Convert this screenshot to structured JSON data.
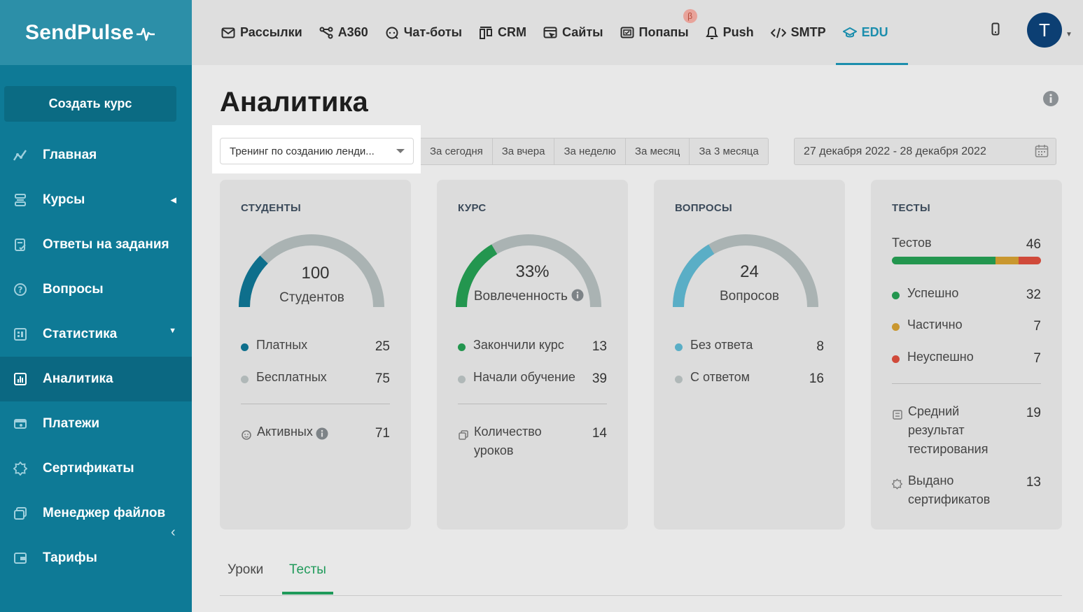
{
  "brand": {
    "name": "SendPulse"
  },
  "sidebar": {
    "create_button": "Создать курс",
    "items": [
      {
        "label": "Главная",
        "icon": "chart-line-icon"
      },
      {
        "label": "Курсы",
        "icon": "layers-icon"
      },
      {
        "label": "Ответы на задания",
        "icon": "task-check-icon"
      },
      {
        "label": "Вопросы",
        "icon": "question-icon"
      },
      {
        "label": "Статистика",
        "icon": "stats-icon"
      },
      {
        "label": "Аналитика",
        "icon": "analytics-icon",
        "active": true
      },
      {
        "label": "Платежи",
        "icon": "wallet-icon"
      },
      {
        "label": "Сертификаты",
        "icon": "certificate-icon"
      },
      {
        "label": "Менеджер файлов",
        "icon": "files-icon"
      },
      {
        "label": "Тарифы",
        "icon": "pricing-icon"
      }
    ]
  },
  "topnav": {
    "items": [
      {
        "label": "Рассылки",
        "icon": "mail-icon"
      },
      {
        "label": "A360",
        "icon": "flow-icon"
      },
      {
        "label": "Чат-боты",
        "icon": "chat-icon"
      },
      {
        "label": "CRM",
        "icon": "crm-icon"
      },
      {
        "label": "Сайты",
        "icon": "sites-icon"
      },
      {
        "label": "Попапы",
        "icon": "popup-icon",
        "badge": "β"
      },
      {
        "label": "Push",
        "icon": "bell-icon"
      },
      {
        "label": "SMTP",
        "icon": "code-icon"
      },
      {
        "label": "EDU",
        "icon": "graduation-cap-icon",
        "active": true
      }
    ],
    "avatar_letter": "T"
  },
  "page": {
    "title": "Аналитика",
    "course_select": "Тренинг по созданию ленди...",
    "periods": [
      "За сегодня",
      "За вчера",
      "За неделю",
      "За месяц",
      "За 3 месяца"
    ],
    "date_range": "27 декабря 2022 - 28 декабря 2022"
  },
  "cards": {
    "students": {
      "title": "СТУДЕНТЫ",
      "value": "100",
      "label": "Студентов",
      "gauge_fraction": 0.25,
      "rows": [
        {
          "label": "Платных",
          "value": "25",
          "color": "#0e6f8c"
        },
        {
          "label": "Бесплатных",
          "value": "75",
          "color": "#b0b8b8"
        }
      ],
      "extra": {
        "label": "Активных",
        "value": "71"
      }
    },
    "course": {
      "title": "КУРС",
      "value": "33%",
      "label": "Вовлеченность",
      "gauge_fraction": 0.33,
      "rows": [
        {
          "label": "Закончили курс",
          "value": "13",
          "color": "#23964f"
        },
        {
          "label": "Начали обучение",
          "value": "39",
          "color": "#b0b8b8"
        }
      ],
      "extra": {
        "label_line1": "Количество",
        "label_line2": "уроков",
        "value": "14"
      }
    },
    "questions": {
      "title": "ВОПРОСЫ",
      "value": "24",
      "label": "Вопросов",
      "gauge_fraction": 0.33,
      "rows": [
        {
          "label": "Без ответа",
          "value": "8",
          "color": "#5aaec6"
        },
        {
          "label": "С ответом",
          "value": "16",
          "color": "#b0b8b8"
        }
      ]
    },
    "tests": {
      "title": "ТЕСТЫ",
      "total_label": "Тестов",
      "total": "46",
      "rows": [
        {
          "label": "Успешно",
          "value": "32",
          "color": "#23964f"
        },
        {
          "label": "Частично",
          "value": "7",
          "color": "#c9972f"
        },
        {
          "label": "Неуспешно",
          "value": "7",
          "color": "#d04a3a"
        }
      ],
      "avg": {
        "l1": "Средний",
        "l2": "результат",
        "l3": "тестирования",
        "value": "19"
      },
      "certs": {
        "l1": "Выдано",
        "l2": "сертификатов",
        "value": "13"
      }
    }
  },
  "tabs": [
    "Уроки",
    "Тесты"
  ]
}
